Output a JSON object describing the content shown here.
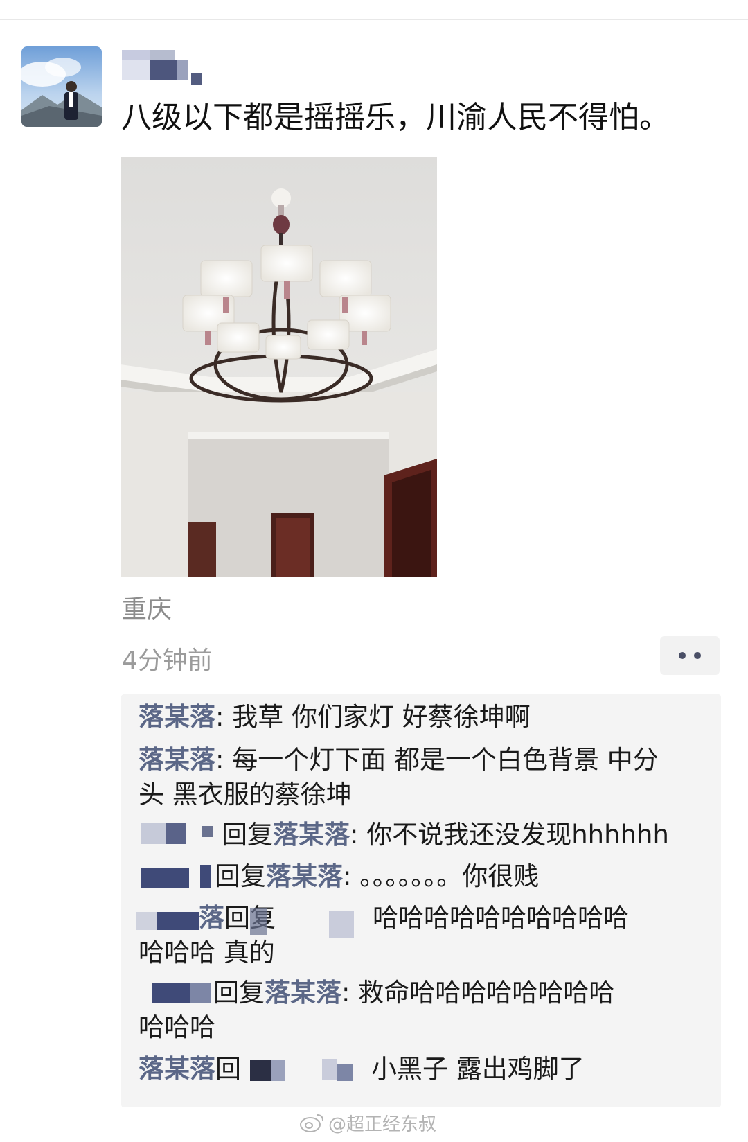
{
  "post": {
    "text": "八级以下都是摇摇乐，川渝人民不得怕。",
    "location": "重庆",
    "time": "4分钟前"
  },
  "comments": [
    {
      "nick": "落某落",
      "sep": ": ",
      "text": "我草 你们家灯 好蔡徐坤啊"
    },
    {
      "nick": "落某落",
      "sep": ": ",
      "text": "每一个灯下面 都是一个白色背景 中分",
      "text2": "头 黑衣服的蔡徐坤"
    },
    {
      "reply": "回复",
      "target": "落某落",
      "sep": ": ",
      "text": "你不说我还没发现hhhhhh"
    },
    {
      "reply": "回复",
      "target": "落某落",
      "sep": ": ",
      "text": "。。。。。。。你很贱"
    },
    {
      "nick_tail": "落",
      "reply": "回复",
      "text": "哈哈哈哈哈哈哈哈哈哈",
      "text2": "哈哈哈 真的"
    },
    {
      "reply": "回复",
      "target": "落某落",
      "sep": ": ",
      "text": "救命哈哈哈哈哈哈哈哈",
      "text2": "哈哈哈"
    },
    {
      "nick": "落某落",
      "reply": "回",
      "text": "小黑子 露出鸡脚了"
    }
  ],
  "watermark": {
    "text": "@超正经东叔",
    "icon": "weibo-icon"
  },
  "colors": {
    "nick": "#5b6787",
    "text": "#1a1a1a",
    "meta": "#9b9b9b",
    "comment_bg": "#f4f4f4"
  }
}
